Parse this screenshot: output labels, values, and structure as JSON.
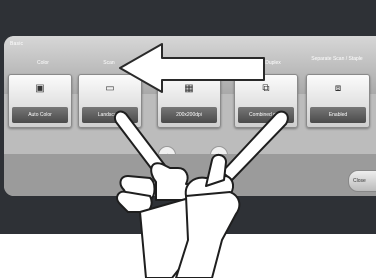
{
  "screen": {
    "title": "Basic",
    "categories": [
      "Color",
      "Scan",
      "",
      "Duplex",
      "Separate Scan / Staple"
    ],
    "buttons": [
      {
        "label": "Auto Color",
        "icon": "color-icon"
      },
      {
        "label": "Landscape",
        "icon": "paper-icon"
      },
      {
        "label": "200x200dpi",
        "icon": "resolution-icon"
      },
      {
        "label": "Combined print",
        "icon": "duplex-icon"
      },
      {
        "label": "Enabled",
        "icon": "staple-icon"
      }
    ],
    "nav": {
      "prev": "‹",
      "next": "›"
    },
    "side_button": "Close"
  },
  "gesture": {
    "direction": "swipe-left",
    "arrow_color": "#ffffff",
    "hand_color": "#ffffff"
  }
}
